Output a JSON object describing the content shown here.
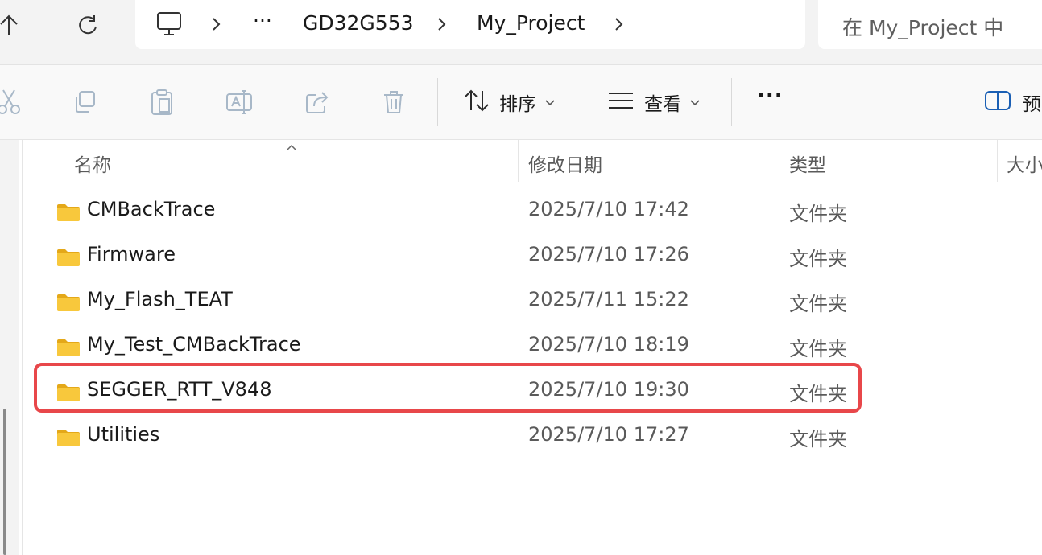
{
  "address_bar": {
    "overflow": "···",
    "segments": [
      "GD32G553",
      "My_Project"
    ]
  },
  "search": {
    "placeholder": "在 My_Project 中"
  },
  "toolbar": {
    "sort_label": "排序",
    "view_label": "查看",
    "more_label": "···",
    "preview_label": "预"
  },
  "columns": {
    "name": "名称",
    "date": "修改日期",
    "type": "类型",
    "size": "大小"
  },
  "files": [
    {
      "name": "CMBackTrace",
      "modified": "2025/7/10 17:42",
      "type": "文件夹"
    },
    {
      "name": "Firmware",
      "modified": "2025/7/10 17:26",
      "type": "文件夹"
    },
    {
      "name": "My_Flash_TEAT",
      "modified": "2025/7/11 15:22",
      "type": "文件夹"
    },
    {
      "name": "My_Test_CMBackTrace",
      "modified": "2025/7/10 18:19",
      "type": "文件夹"
    },
    {
      "name": "SEGGER_RTT_V848",
      "modified": "2025/7/10 19:30",
      "type": "文件夹"
    },
    {
      "name": "Utilities",
      "modified": "2025/7/10 17:27",
      "type": "文件夹"
    }
  ],
  "colors": {
    "highlight": "#e8474a",
    "folder": "#f8c83c",
    "folder_tab": "#e4a819"
  }
}
